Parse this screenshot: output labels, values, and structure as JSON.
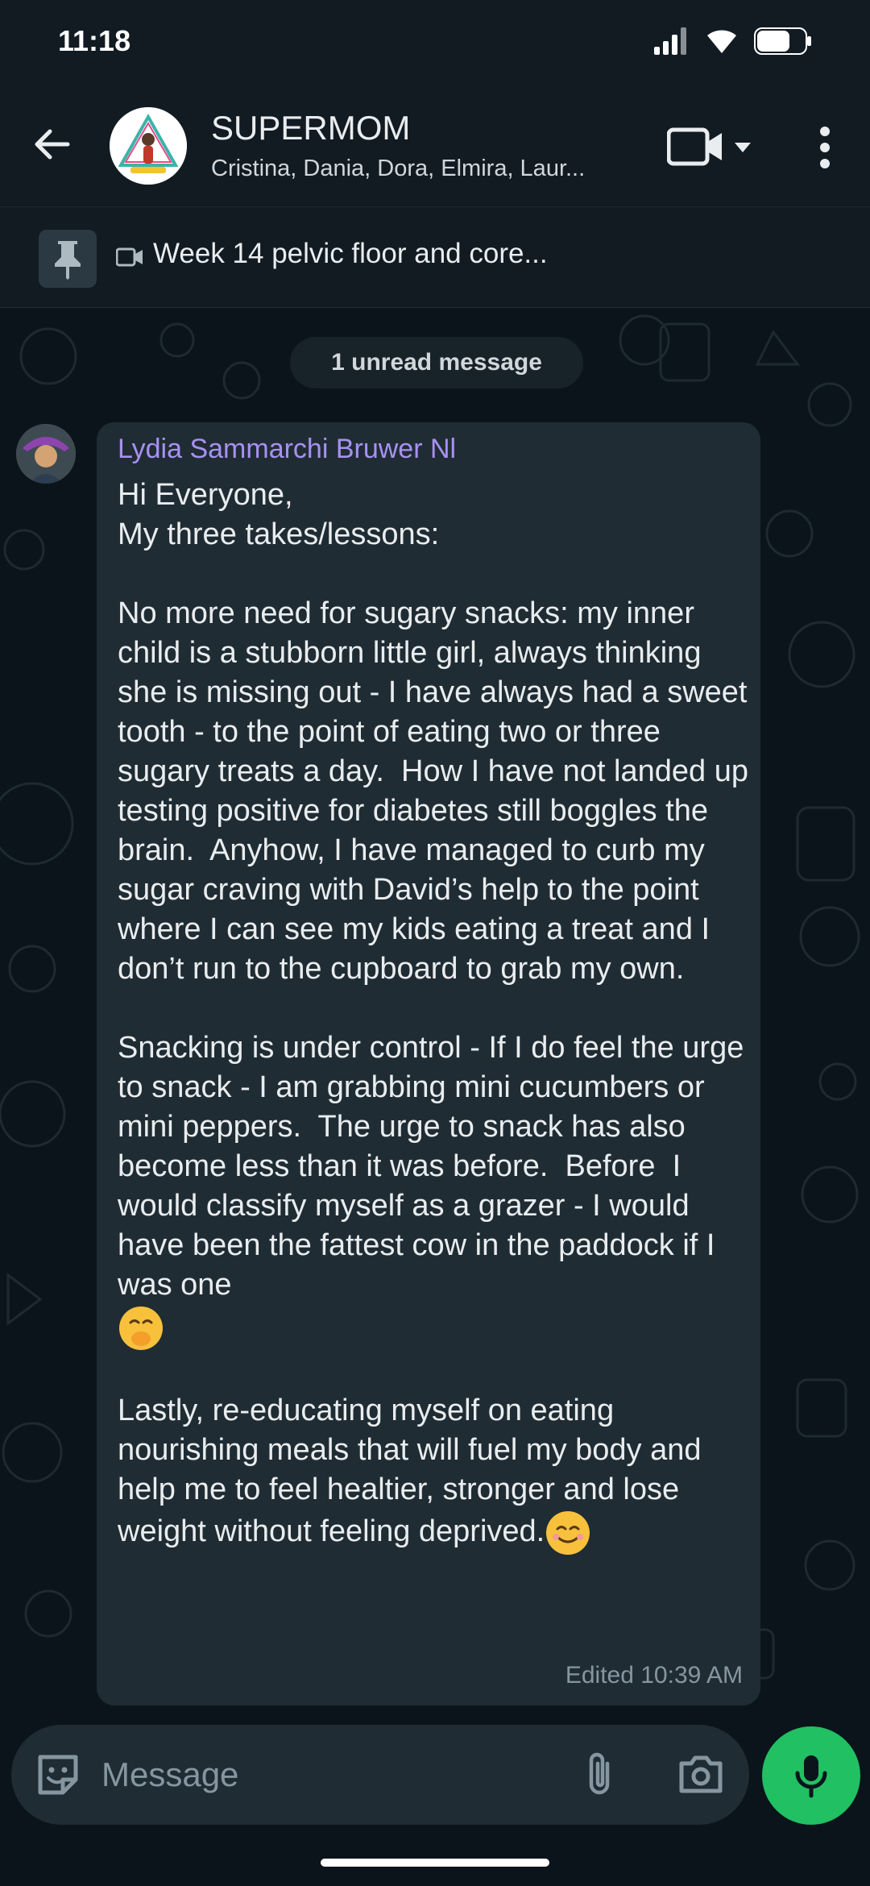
{
  "status": {
    "time": "11:18"
  },
  "header": {
    "title": "SUPERMOM",
    "subtitle": "Cristina, Dania, Dora, Elmira, Laur...",
    "avatar_icon": "group-logo-icon"
  },
  "pinned": {
    "text": "Week 14 pelvic floor and core..."
  },
  "chat": {
    "unread_label": "1 unread message"
  },
  "message": {
    "sender": "Lydia Sammarchi Bruwer Nl",
    "paragraphs": {
      "p1": "Hi Everyone,\nMy three takes/lessons:",
      "p2": "No more need for sugary snacks: my inner child is a stubborn little girl, always thinking she is missing out - I have always had a sweet tooth - to the point of eating two or three sugary treats a day.  How I have not landed up testing positive for diabetes still boggles the brain.  Anyhow, I have managed to curb my sugar craving with David’s help to the point where I can see my kids eating a treat and I don’t run to the cupboard to grab my own.",
      "p3": "Snacking is under control - If I do feel the urge to snack - I am grabbing mini cucumbers or mini peppers.  The urge to snack has also become less than it was before.  Before  I would classify myself as a grazer - I would have been the fattest cow in the paddock if I was one",
      "p4": "Lastly, re-educating myself on eating nourishing meals that will fuel my body and help me to feel healtier, stronger and lose weight without feeling deprived."
    },
    "meta": "Edited 10:39 AM"
  },
  "input": {
    "placeholder": "Message"
  },
  "colors": {
    "background": "#0b141a",
    "bubble": "#202c33",
    "sender_name": "#a791f2",
    "mic_button": "#21c063"
  }
}
